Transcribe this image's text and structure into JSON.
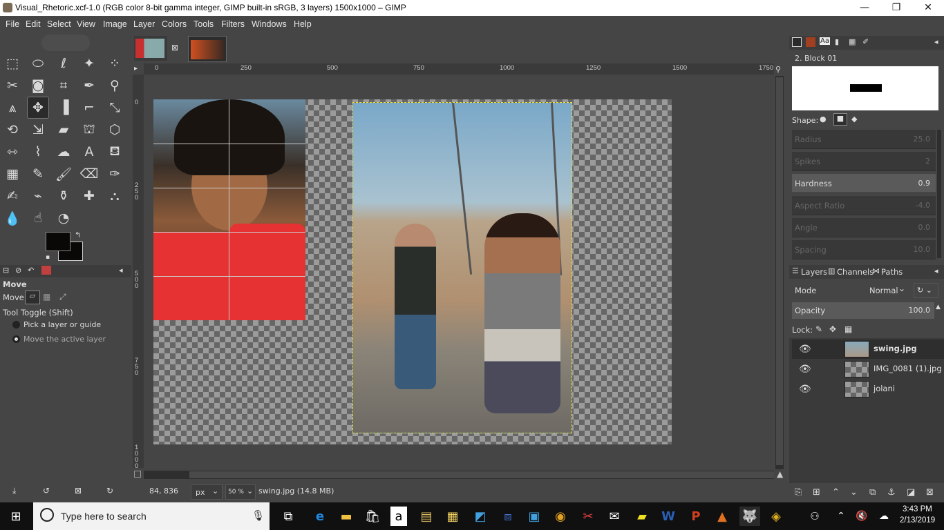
{
  "window": {
    "title": "Visual_Rhetoric.xcf-1.0 (RGB color 8-bit gamma integer, GIMP built-in sRGB, 3 layers) 1500x1000 – GIMP",
    "minimize": "—",
    "maximize": "❐",
    "close": "✕"
  },
  "menu": [
    "File",
    "Edit",
    "Select",
    "View",
    "Image",
    "Layer",
    "Colors",
    "Tools",
    "Filters",
    "Windows",
    "Help"
  ],
  "ruler": {
    "h_labels": [
      "0",
      "250",
      "500",
      "750",
      "1000",
      "1250",
      "1500",
      "1750"
    ],
    "v_labels": [
      "0",
      "2\n5\n0",
      "5\n0\n0",
      "7\n5\n0",
      "1\n0\n0\n0"
    ]
  },
  "tool_options": {
    "title": "Move",
    "move_label": "Move:",
    "toggle_label": "Tool Toggle  (Shift)",
    "option1": "Pick a layer or guide",
    "option2": "Move the active layer"
  },
  "brushes": {
    "brush_name": "2. Block 01",
    "shape_label": "Shape:",
    "sliders": [
      {
        "label": "Radius",
        "value": "25.0"
      },
      {
        "label": "Spikes",
        "value": "2"
      },
      {
        "label": "Hardness",
        "value": "0.9"
      },
      {
        "label": "Aspect Ratio",
        "value": "-4.0"
      },
      {
        "label": "Angle",
        "value": "0.0"
      },
      {
        "label": "Spacing",
        "value": "10.0"
      }
    ]
  },
  "layers_panel": {
    "tabs": [
      "Layers",
      "Channels",
      "Paths"
    ],
    "mode_label": "Mode",
    "mode_value": "Normal",
    "opacity_label": "Opacity",
    "opacity_value": "100.0",
    "lock_label": "Lock:",
    "layers": [
      {
        "name": "swing.jpg"
      },
      {
        "name": "IMG_0081 (1).jpg"
      },
      {
        "name": "jolani"
      }
    ]
  },
  "status": {
    "coords": "84, 836",
    "unit": "px",
    "zoom": "50 %",
    "info": "swing.jpg (14.8 MB)"
  },
  "taskbar": {
    "search_placeholder": "Type here to search",
    "time": "3:43 PM",
    "date": "2/13/2019"
  },
  "colors": {
    "panel_bg": "#454545",
    "puzzle_red": "#e63232",
    "taskbar": "#101010"
  }
}
